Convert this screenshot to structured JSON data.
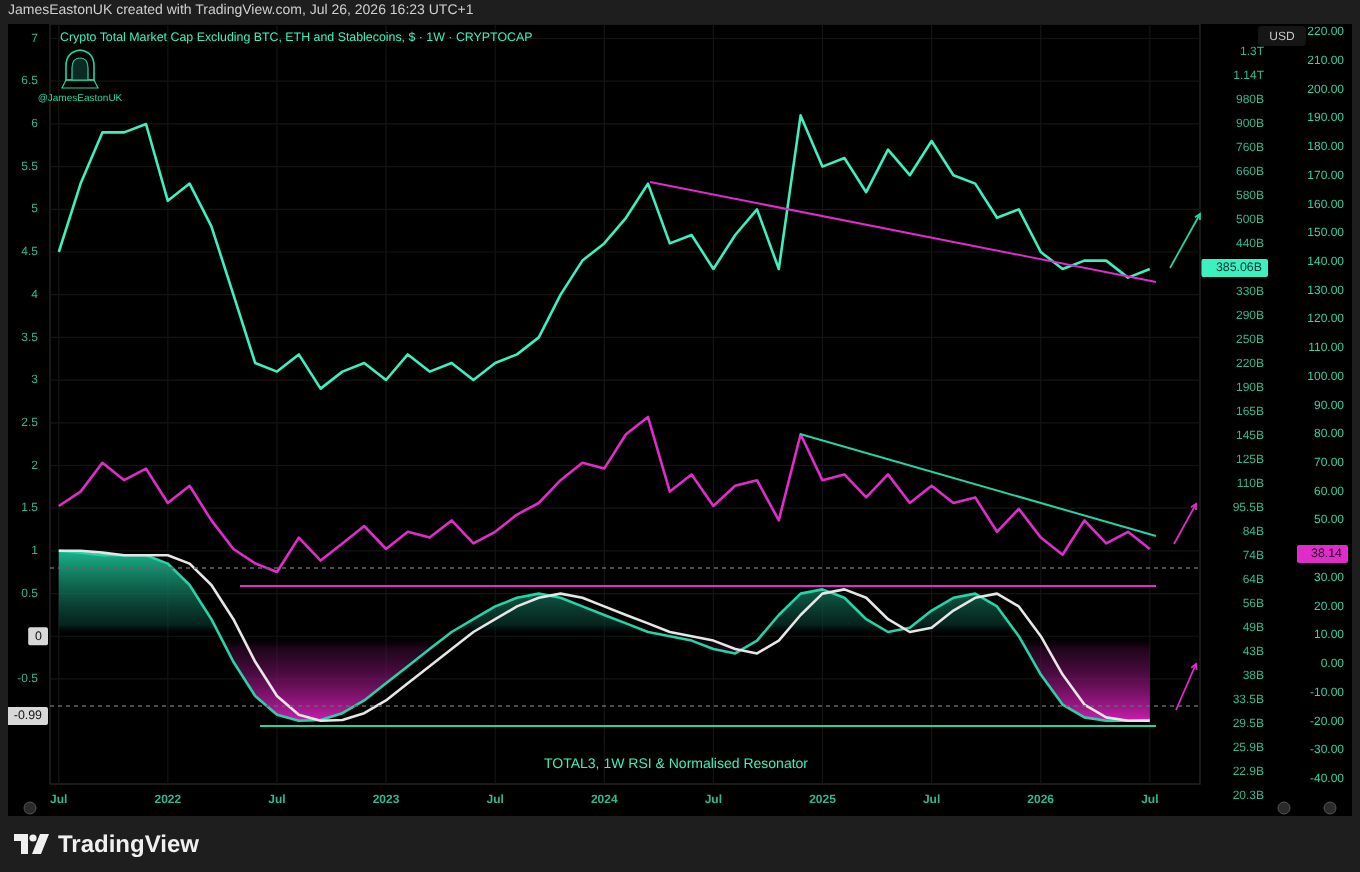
{
  "header": {
    "text": "JamesEastonUK created with TradingView.com, Jul 26, 2026 16:23 UTC+1"
  },
  "logo": {
    "handle": "@JamesEastonUK"
  },
  "currency_button": "USD",
  "left_last_value": "-0.99",
  "price_axis": [
    "1.3T",
    "1.14T",
    "980B",
    "900B",
    "760B",
    "660B",
    "580B",
    "500B",
    "440B",
    "330B",
    "290B",
    "250B",
    "220B",
    "190B",
    "165B",
    "145B",
    "125B",
    "110B",
    "95.5B",
    "84B",
    "74B",
    "64B",
    "56B",
    "49B",
    "43B",
    "38B",
    "33.5B",
    "29.5B",
    "25.9B",
    "22.9B",
    "20.3B"
  ],
  "price_last_value": "385.06B",
  "rsi_last_value": "38.14",
  "chart_data": {
    "type": "line",
    "title": "Crypto Total Market Cap Excluding BTC, ETH and Stablecoins, $ · 1W · CRYPTOCAP",
    "grid": true,
    "xlim": [
      2021.46,
      2026.73
    ],
    "ylim": [
      -1.73,
      7.17
    ],
    "y2lim": [
      -41.8,
      222.8
    ],
    "x": [
      2021.5,
      2021.6,
      2021.7,
      2021.8,
      2021.9,
      2022.0,
      2022.1,
      2022.2,
      2022.3,
      2022.4,
      2022.5,
      2022.6,
      2022.7,
      2022.8,
      2022.9,
      2023.0,
      2023.1,
      2023.2,
      2023.3,
      2023.4,
      2023.5,
      2023.6,
      2023.7,
      2023.8,
      2023.9,
      2024.0,
      2024.1,
      2024.2,
      2024.3,
      2024.4,
      2024.5,
      2024.6,
      2024.7,
      2024.8,
      2024.9,
      2025.0,
      2025.1,
      2025.2,
      2025.3,
      2025.4,
      2025.5,
      2025.6,
      2025.7,
      2025.8,
      2025.9,
      2026.0,
      2026.1,
      2026.2,
      2026.3,
      2026.4,
      2026.5
    ],
    "xticks": [
      {
        "value": 2021.5,
        "label": "Jul"
      },
      {
        "value": 2022,
        "label": "2022"
      },
      {
        "value": 2022.5,
        "label": "Jul"
      },
      {
        "value": 2023,
        "label": "2023"
      },
      {
        "value": 2023.5,
        "label": "Jul"
      },
      {
        "value": 2024,
        "label": "2024"
      },
      {
        "value": 2024.5,
        "label": "Jul"
      },
      {
        "value": 2025,
        "label": "2025"
      },
      {
        "value": 2025.5,
        "label": "Jul"
      },
      {
        "value": 2026,
        "label": "2026"
      },
      {
        "value": 2026.5,
        "label": "Jul"
      }
    ],
    "yticks": [
      7,
      6.5,
      6,
      5.5,
      5,
      4.5,
      4,
      3.5,
      3,
      2.5,
      2,
      1.5,
      1,
      0.5,
      0,
      -0.5
    ],
    "y2ticks": [
      {
        "value": 220,
        "label": "220.00"
      },
      {
        "value": 210,
        "label": "210.00"
      },
      {
        "value": 200,
        "label": "200.00"
      },
      {
        "value": 190,
        "label": "190.00"
      },
      {
        "value": 180,
        "label": "180.00"
      },
      {
        "value": 170,
        "label": "170.00"
      },
      {
        "value": 160,
        "label": "160.00"
      },
      {
        "value": 150,
        "label": "150.00"
      },
      {
        "value": 140,
        "label": "140.00"
      },
      {
        "value": 130,
        "label": "130.00"
      },
      {
        "value": 120,
        "label": "120.00"
      },
      {
        "value": 110,
        "label": "110.00"
      },
      {
        "value": 100,
        "label": "100.00"
      },
      {
        "value": 90,
        "label": "90.00"
      },
      {
        "value": 80,
        "label": "80.00"
      },
      {
        "value": 70,
        "label": "70.00"
      },
      {
        "value": 60,
        "label": "60.00"
      },
      {
        "value": 50,
        "label": "50.00"
      },
      {
        "value": 30,
        "label": "30.00"
      },
      {
        "value": 20,
        "label": "20.00"
      },
      {
        "value": 10,
        "label": "10.00"
      },
      {
        "value": 0,
        "label": "0.00"
      },
      {
        "value": -10,
        "label": "-10.00"
      },
      {
        "value": -20,
        "label": "-20.00"
      },
      {
        "value": -30,
        "label": "-30.00"
      },
      {
        "value": -40,
        "label": "-40.00"
      }
    ],
    "series": [
      {
        "color": "#3cf0c0",
        "values": [
          4.5,
          5.3,
          5.9,
          5.9,
          6.0,
          5.1,
          5.3,
          4.8,
          4.0,
          3.2,
          3.1,
          3.3,
          2.9,
          3.1,
          3.2,
          3.0,
          3.3,
          3.1,
          3.2,
          3.0,
          3.2,
          3.3,
          3.5,
          4.0,
          4.4,
          4.6,
          4.9,
          5.3,
          4.6,
          4.7,
          4.3,
          4.7,
          5.0,
          4.3,
          6.1,
          5.5,
          5.6,
          5.2,
          5.7,
          5.4,
          5.8,
          5.4,
          5.3,
          4.9,
          5.0,
          4.5,
          4.3,
          4.4,
          4.4,
          4.2,
          4.3
        ]
      },
      {
        "color": "#e02cc8",
        "axis": "y2",
        "values": [
          55,
          60,
          70,
          64,
          68,
          56,
          62,
          50,
          40,
          35,
          32,
          44,
          36,
          42,
          48,
          40,
          46,
          44,
          50,
          42,
          46,
          52,
          56,
          64,
          70,
          68,
          80,
          86,
          60,
          66,
          55,
          62,
          64,
          50,
          80,
          64,
          66,
          58,
          66,
          56,
          62,
          56,
          58,
          46,
          54,
          44,
          38,
          50,
          42,
          46,
          40
        ]
      },
      {
        "color": "#26d3a6",
        "values": [
          1.0,
          0.98,
          0.95,
          0.95,
          0.95,
          0.85,
          0.6,
          0.2,
          -0.3,
          -0.7,
          -0.92,
          -0.99,
          -0.98,
          -0.9,
          -0.75,
          -0.55,
          -0.35,
          -0.15,
          0.05,
          0.2,
          0.35,
          0.45,
          0.5,
          0.45,
          0.35,
          0.25,
          0.15,
          0.05,
          0.0,
          -0.05,
          -0.15,
          -0.2,
          -0.05,
          0.25,
          0.5,
          0.55,
          0.45,
          0.2,
          0.05,
          0.1,
          0.3,
          0.45,
          0.5,
          0.35,
          0.0,
          -0.45,
          -0.8,
          -0.95,
          -0.99,
          -0.99,
          -0.98
        ]
      },
      {
        "color": "#e6e6e6",
        "values": [
          1.0,
          1.0,
          0.98,
          0.95,
          0.95,
          0.95,
          0.85,
          0.6,
          0.2,
          -0.3,
          -0.7,
          -0.92,
          -0.99,
          -0.98,
          -0.9,
          -0.75,
          -0.55,
          -0.35,
          -0.15,
          0.05,
          0.2,
          0.35,
          0.45,
          0.5,
          0.45,
          0.35,
          0.25,
          0.15,
          0.05,
          0.0,
          -0.05,
          -0.15,
          -0.2,
          -0.05,
          0.25,
          0.5,
          0.55,
          0.45,
          0.2,
          0.05,
          0.1,
          0.3,
          0.45,
          0.5,
          0.35,
          0.0,
          -0.45,
          -0.8,
          -0.95,
          -0.99,
          -0.99
        ]
      }
    ]
  },
  "pane_caption": "TOTAL3, 1W RSI & Normalised Resonator",
  "footer": {
    "brand": "TradingView"
  }
}
